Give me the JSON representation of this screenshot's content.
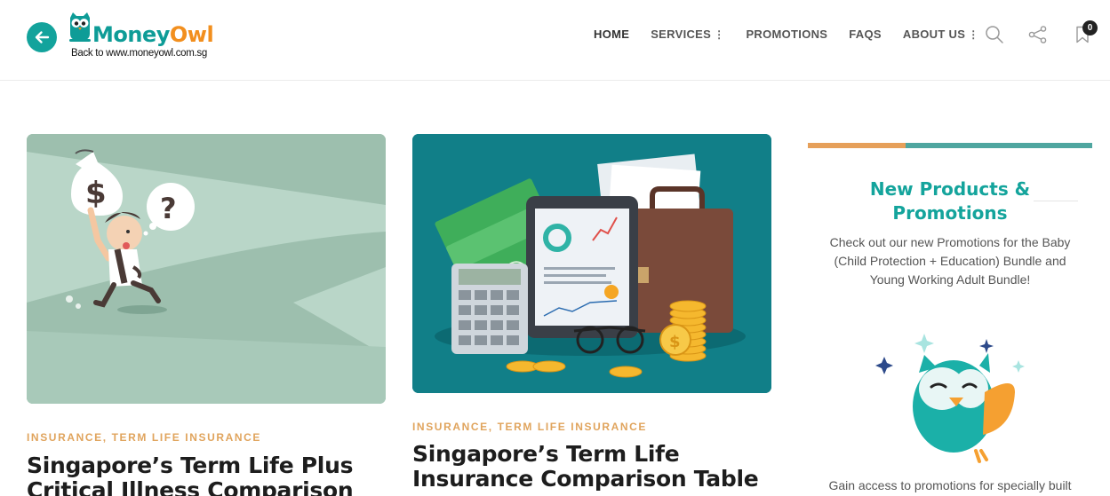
{
  "brand": {
    "name_part1": "Money",
    "name_part2": "Owl",
    "back_link": "Back to www.moneyowl.com.sg",
    "teal": "#13a39c",
    "orange": "#f28f1e"
  },
  "nav": {
    "items": [
      {
        "label": "HOME",
        "active": true
      },
      {
        "label": "SERVICES",
        "has_menu": true
      },
      {
        "label": "PROMOTIONS"
      },
      {
        "label": "FAQS"
      },
      {
        "label": "ABOUT US",
        "has_menu": true
      }
    ],
    "menu_dots": "⋮",
    "icons": [
      "search-icon",
      "share-icon",
      "bookmark-icon"
    ],
    "cart_count": "0"
  },
  "posts": [
    {
      "category": "INSURANCE, TERM LIFE INSURANCE",
      "title_line1": "Singapore’s Term Life Plus",
      "title_line2": "Critical Illness Comparison"
    },
    {
      "category": "INSURANCE, TERM LIFE INSURANCE",
      "title_line1": "Singapore’s Term Life",
      "title_line2": "Insurance Comparison Table"
    }
  ],
  "sidebar": {
    "title_line1": "New Products &",
    "title_line2": "Promotions",
    "text": "Check out our new Promotions for the Baby (Child Protection + Education) Bundle and Young Working Adult Bundle!",
    "text2": "Gain access to promotions for specially built"
  }
}
